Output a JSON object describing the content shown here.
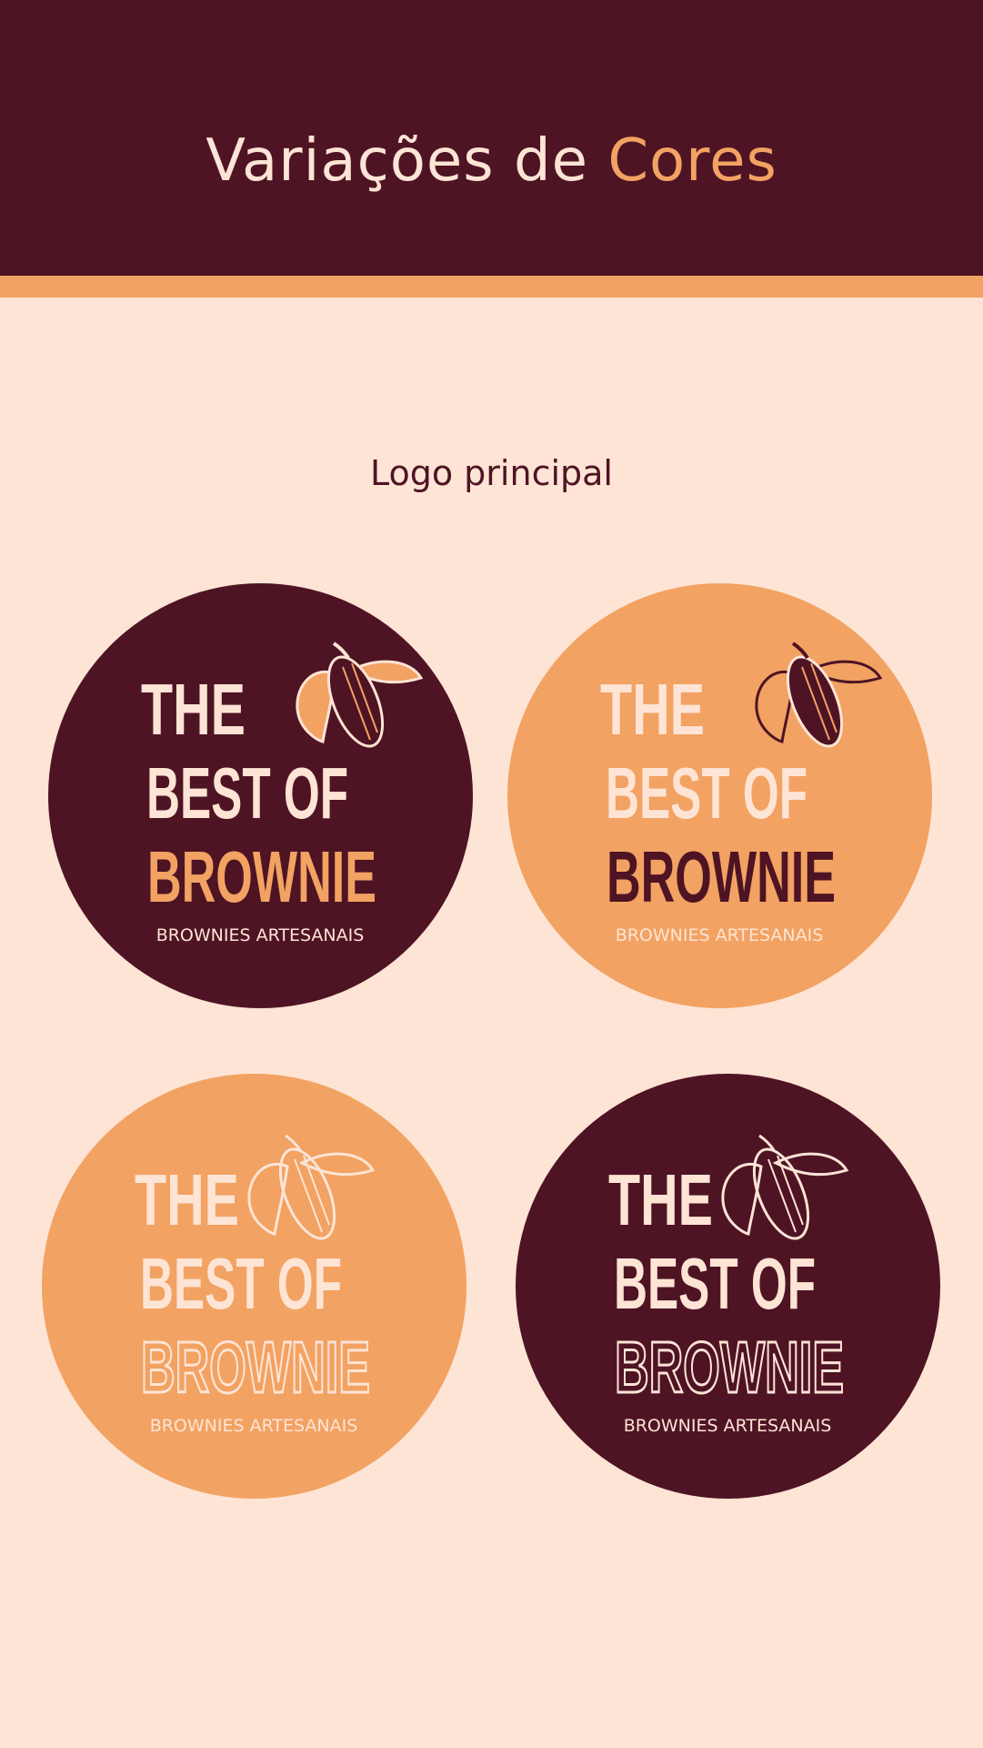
{
  "header": {
    "title_main": "Variações de ",
    "title_accent": "Cores"
  },
  "section": {
    "title": "Logo principal"
  },
  "colors": {
    "plum": "#4e1424",
    "orange": "#f2a262",
    "cream": "#fee4d5"
  },
  "logos": [
    {
      "line1": "THE",
      "line2": "BEST OF",
      "line3": "BROWNIE",
      "tagline": "BROWNIES ARTESANAIS",
      "icon": "cacao-pod-icon"
    },
    {
      "line1": "THE",
      "line2": "BEST OF",
      "line3": "BROWNIE",
      "tagline": "BROWNIES ARTESANAIS",
      "icon": "cacao-pod-icon"
    },
    {
      "line1": "THE",
      "line2": "BEST OF",
      "line3": "BROWNIE",
      "tagline": "BROWNIES ARTESANAIS",
      "icon": "cacao-pod-icon"
    },
    {
      "line1": "THE",
      "line2": "BEST OF",
      "line3": "BROWNIE",
      "tagline": "BROWNIES ARTESANAIS",
      "icon": "cacao-pod-icon"
    }
  ]
}
